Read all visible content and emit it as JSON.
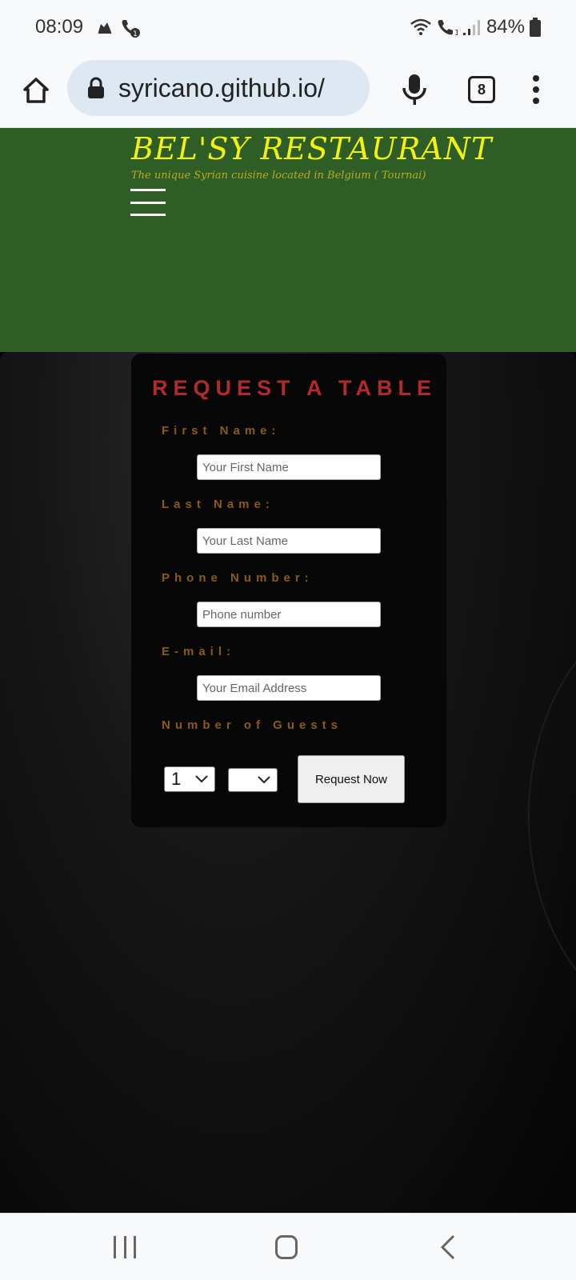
{
  "status_bar": {
    "time": "08:09",
    "battery": "84%",
    "icons": [
      "notification-app-icon",
      "wifi-call-icon",
      "wifi-icon",
      "vowifi-icon",
      "signal-icon",
      "battery-icon"
    ]
  },
  "browser": {
    "url": "syricano.github.io/",
    "tab_count": "8",
    "icons": [
      "home-icon",
      "lock-icon",
      "mic-icon",
      "tabs-icon",
      "more-vert-icon"
    ]
  },
  "site": {
    "brand": "BEL'SY RESTAURANT",
    "tagline": "The unique Syrian cuisine located in Belgium ( Tournai)",
    "colors": {
      "header_bg": "#2e5e25",
      "brand": "#f2f20d",
      "title": "#b32a2a",
      "label": "#8a5a16"
    }
  },
  "form": {
    "title": "REQUEST A TABLE",
    "first_name_label": "First Name:",
    "first_name_placeholder": "Your First Name",
    "last_name_label": "Last Name:",
    "last_name_placeholder": "Your Last Name",
    "phone_label": "Phone Number:",
    "phone_placeholder": "Phone number",
    "email_label": "E-mail:",
    "email_placeholder": "Your Email Address",
    "guests_label": "Number of Guests",
    "guests_selected": "1",
    "second_select_value": "",
    "submit_label": "Request Now"
  },
  "nav": {
    "icons": [
      "recents-icon",
      "home-nav-icon",
      "back-icon"
    ]
  }
}
